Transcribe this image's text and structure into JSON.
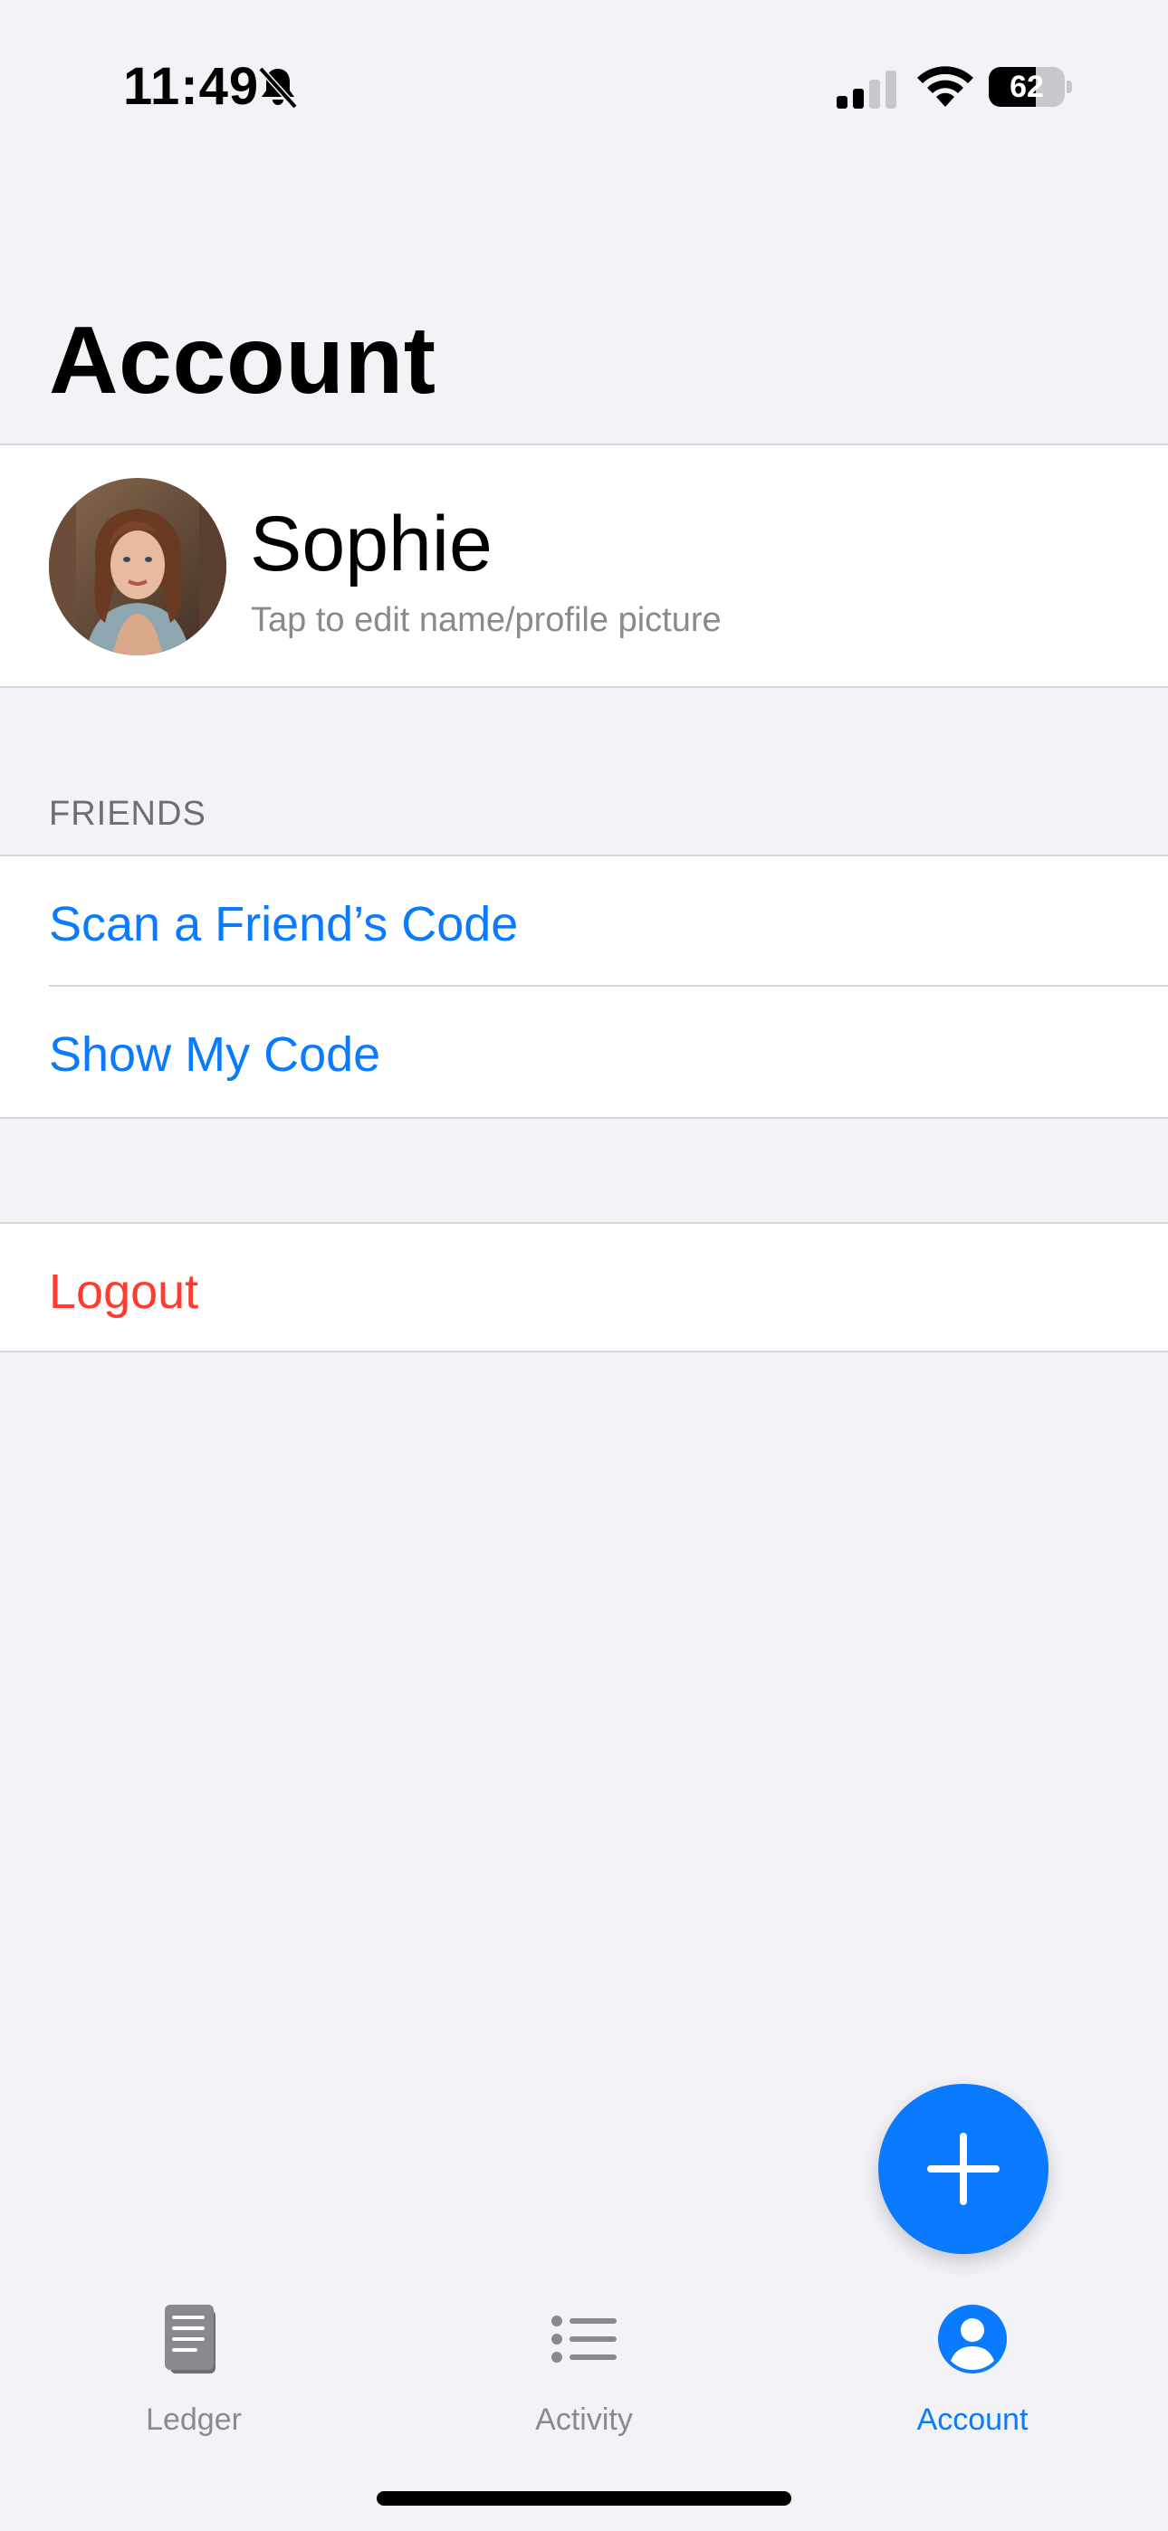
{
  "status_bar": {
    "time": "11:49",
    "battery_percent": 62,
    "battery_label": "62",
    "icons": [
      "bell-slash-icon",
      "cellular-signal-icon",
      "wifi-icon",
      "battery-icon"
    ]
  },
  "page": {
    "title": "Account"
  },
  "profile": {
    "name": "Sophie",
    "subtitle": "Tap to edit name/profile picture"
  },
  "friends": {
    "header": "FRIENDS",
    "items": [
      {
        "label": "Scan a Friend’s Code"
      },
      {
        "label": "Show My Code"
      }
    ]
  },
  "account_actions": {
    "logout_label": "Logout"
  },
  "tab_bar": {
    "tabs": [
      {
        "label": "Ledger",
        "icon": "ledger-icon",
        "active": false
      },
      {
        "label": "Activity",
        "icon": "list-icon",
        "active": false
      },
      {
        "label": "Account",
        "icon": "person-circle-icon",
        "active": true
      }
    ]
  },
  "colors": {
    "accent": "#0A7AFF",
    "destructive": "#FF3B30",
    "background": "#F2F2F7",
    "secondary_text": "#8A8A8E"
  },
  "fab": {
    "icon": "plus-icon"
  }
}
